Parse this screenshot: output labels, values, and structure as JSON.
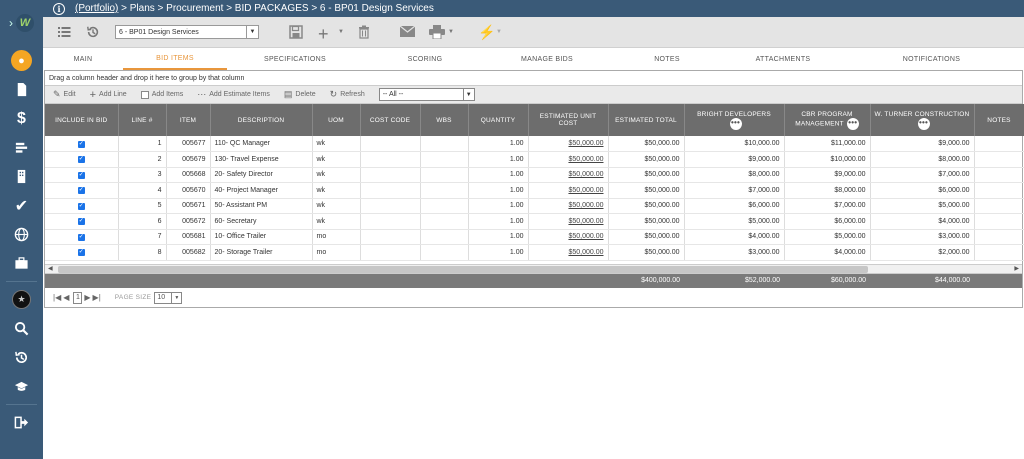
{
  "breadcrumb": {
    "portfolio": "(Portfolio)",
    "rest": " > Plans > Procurement > BID PACKAGES > 6 - BP01 Design Services"
  },
  "toolbar": {
    "package_select": "6 -  BP01 Design Services"
  },
  "tabs": [
    "MAIN",
    "BID ITEMS",
    "SPECIFICATIONS",
    "SCORING",
    "MANAGE BIDS",
    "NOTES",
    "ATTACHMENTS",
    "NOTIFICATIONS"
  ],
  "active_tab": "BID ITEMS",
  "grid": {
    "group_hint": "Drag a column header and drop it here to group by that column",
    "actions": {
      "edit": "Edit",
      "add_line": "Add Line",
      "add_items": "Add Items",
      "add_estimate_items": "Add Estimate Items",
      "delete": "Delete",
      "refresh": "Refresh"
    },
    "filter_value": "-- All --",
    "columns": {
      "include": "INCLUDE IN BID",
      "line": "LINE #",
      "item": "ITEM",
      "description": "DESCRIPTION",
      "uom": "UOM",
      "cost_code": "COST CODE",
      "wbs": "WBS",
      "quantity": "QUANTITY",
      "unit_cost": "ESTIMATED UNIT COST",
      "total": "ESTIMATED TOTAL",
      "bidder1": "BRIGHT DEVELOPERS",
      "bidder2": "CBR PROGRAM MANAGEMENT",
      "bidder3": "W. TURNER CONSTRUCTION",
      "notes": "NOTES"
    },
    "rows": [
      {
        "line": "1",
        "item": "005677",
        "description": "110- QC Manager",
        "uom": "wk",
        "quantity": "1.00",
        "unit_cost": "$50,000.00",
        "total": "$50,000.00",
        "b1": "$10,000.00",
        "b2": "$11,000.00",
        "b3": "$9,000.00"
      },
      {
        "line": "2",
        "item": "005679",
        "description": "130- Travel Expense",
        "uom": "wk",
        "quantity": "1.00",
        "unit_cost": "$50,000.00",
        "total": "$50,000.00",
        "b1": "$9,000.00",
        "b2": "$10,000.00",
        "b3": "$8,000.00"
      },
      {
        "line": "3",
        "item": "005668",
        "description": "20- Safety Director",
        "uom": "wk",
        "quantity": "1.00",
        "unit_cost": "$50,000.00",
        "total": "$50,000.00",
        "b1": "$8,000.00",
        "b2": "$9,000.00",
        "b3": "$7,000.00"
      },
      {
        "line": "4",
        "item": "005670",
        "description": "40- Project Manager",
        "uom": "wk",
        "quantity": "1.00",
        "unit_cost": "$50,000.00",
        "total": "$50,000.00",
        "b1": "$7,000.00",
        "b2": "$8,000.00",
        "b3": "$6,000.00"
      },
      {
        "line": "5",
        "item": "005671",
        "description": "50- Assistant PM",
        "uom": "wk",
        "quantity": "1.00",
        "unit_cost": "$50,000.00",
        "total": "$50,000.00",
        "b1": "$6,000.00",
        "b2": "$7,000.00",
        "b3": "$5,000.00"
      },
      {
        "line": "6",
        "item": "005672",
        "description": "60- Secretary",
        "uom": "wk",
        "quantity": "1.00",
        "unit_cost": "$50,000.00",
        "total": "$50,000.00",
        "b1": "$5,000.00",
        "b2": "$6,000.00",
        "b3": "$4,000.00"
      },
      {
        "line": "7",
        "item": "005681",
        "description": "10- Office Trailer",
        "uom": "mo",
        "quantity": "1.00",
        "unit_cost": "$50,000.00",
        "total": "$50,000.00",
        "b1": "$4,000.00",
        "b2": "$5,000.00",
        "b3": "$3,000.00"
      },
      {
        "line": "8",
        "item": "005682",
        "description": "20- Storage Trailer",
        "uom": "mo",
        "quantity": "1.00",
        "unit_cost": "$50,000.00",
        "total": "$50,000.00",
        "b1": "$3,000.00",
        "b2": "$4,000.00",
        "b3": "$2,000.00"
      }
    ],
    "totals": {
      "total": "$400,000.00",
      "b1": "$52,000.00",
      "b2": "$60,000.00",
      "b3": "$44,000.00"
    }
  },
  "pager": {
    "page": "1",
    "page_size_label": "PAGE SIZE",
    "page_size": "10"
  },
  "icons": {
    "active_nav": "lightbulb-icon",
    "accent": "#e8963c",
    "nav_bg": "#3a5a78",
    "checkbox": "#1a73e8"
  }
}
